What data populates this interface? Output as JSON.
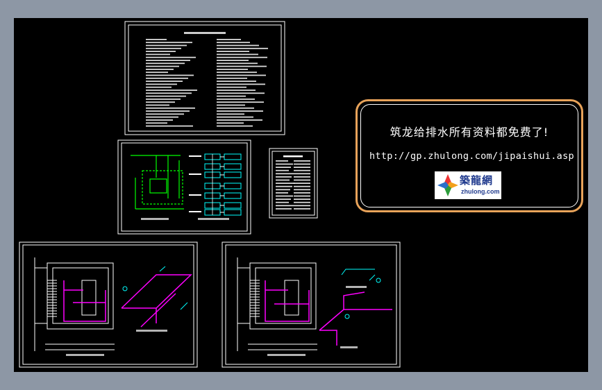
{
  "banner": {
    "title": "筑龙给排水所有资料都免费了!",
    "url": "http://gp.zhulong.com/jipaishui.asp"
  },
  "logo": {
    "chinese": "築龍網",
    "english": "zhulong.com"
  },
  "colors": {
    "background_gray": "#8d97a5",
    "canvas": "#000000",
    "frame": "#ffffff",
    "banner_border": "#e8a35a",
    "pipe_magenta": "#ff00ff",
    "pipe_green": "#00ff00",
    "pipe_cyan": "#00ffff",
    "text_blue": "#223c8f"
  }
}
